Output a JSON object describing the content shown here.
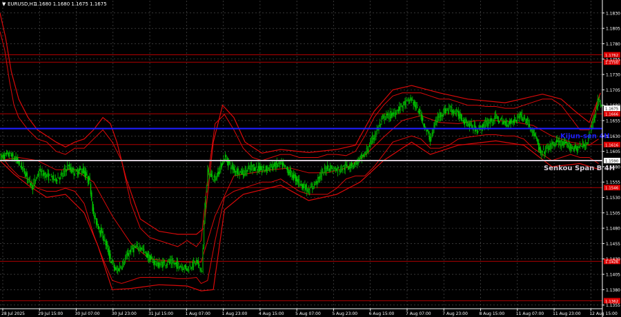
{
  "header": {
    "symbol": "EURUSD,H1",
    "ohlc": "1.1680 1.1680 1.1675 1.1675"
  },
  "chart_data": {
    "type": "candlestick",
    "colors": {
      "background": "#000000",
      "grid": "#5a5a5a",
      "candle_up": "#00c800",
      "candle_down": "#00c800",
      "bollinger_bands": "#dc0a0a",
      "level_lines": "#b40000",
      "kijun_sen": "#1e1eff",
      "senkou_span_b": "#d6cbd6",
      "axis_text": "#ffffff"
    },
    "ylim": [
      1.1349,
      1.185
    ],
    "y_ticks": [
      "1.1830",
      "1.1805",
      "1.1780",
      "1.1755",
      "1.1730",
      "1.1705",
      "1.1680",
      "1.1655",
      "1.1630",
      "1.1605",
      "1.1580",
      "1.1555",
      "1.1530",
      "1.1505",
      "1.1480",
      "1.1455",
      "1.1430",
      "1.1405",
      "1.1380",
      "1.1355"
    ],
    "x_ticks": [
      "28 Jul 2025",
      "29 Jul 15:00",
      "30 Jul 07:00",
      "30 Jul 23:00",
      "31 Jul 15:00",
      "1 Aug 07:00",
      "1 Aug 23:00",
      "4 Aug 15:00",
      "5 Aug 07:00",
      "5 Aug 23:00",
      "6 Aug 15:00",
      "7 Aug 07:00",
      "7 Aug 23:00",
      "8 Aug 15:00",
      "11 Aug 07:00",
      "11 Aug 23:00",
      "12 Aug 15:00"
    ],
    "horizontal_levels": [
      {
        "value": 1.1762,
        "label": "1.1762",
        "color": "#b40000"
      },
      {
        "value": 1.175,
        "label": "1.1750",
        "color": "#b40000"
      },
      {
        "value": 1.1666,
        "label": "1.1666",
        "color": "#b40000"
      },
      {
        "value": 1.1616,
        "label": "1.1616",
        "color": "#b40000"
      },
      {
        "value": 1.1546,
        "label": "1.1546",
        "color": "#b40000"
      },
      {
        "value": 1.1426,
        "label": "1.1426",
        "color": "#b40000"
      },
      {
        "value": 1.1362,
        "label": "1.1362",
        "color": "#b40000"
      }
    ],
    "kijun_sen": {
      "value": 1.1642,
      "label": "Kijun-sen 4H"
    },
    "senkou_span_b": {
      "value": 1.159,
      "price_label": "1.1590",
      "label": "Senkou Span B 4H"
    },
    "current_price": {
      "value": 1.1675,
      "label": "1.1675"
    },
    "close_path": [
      [
        0,
        1.1595
      ],
      [
        10,
        1.16
      ],
      [
        18,
        1.159
      ],
      [
        25,
        1.1575
      ],
      [
        30,
        1.156
      ],
      [
        35,
        1.1548
      ],
      [
        42,
        1.1572
      ],
      [
        50,
        1.1565
      ],
      [
        58,
        1.156
      ],
      [
        66,
        1.1565
      ],
      [
        72,
        1.158
      ],
      [
        80,
        1.157
      ],
      [
        88,
        1.1575
      ],
      [
        96,
        1.1555
      ],
      [
        100,
        1.15
      ],
      [
        106,
        1.148
      ],
      [
        112,
        1.146
      ],
      [
        118,
        1.143
      ],
      [
        124,
        1.141
      ],
      [
        130,
        1.142
      ],
      [
        140,
        1.1445
      ],
      [
        150,
        1.145
      ],
      [
        160,
        1.143
      ],
      [
        170,
        1.142
      ],
      [
        180,
        1.1425
      ],
      [
        190,
        1.142
      ],
      [
        200,
        1.1415
      ],
      [
        210,
        1.1425
      ],
      [
        216,
        1.141
      ],
      [
        219,
        1.152
      ],
      [
        222,
        1.157
      ],
      [
        230,
        1.156
      ],
      [
        240,
        1.1595
      ],
      [
        250,
        1.1575
      ],
      [
        260,
        1.157
      ],
      [
        270,
        1.158
      ],
      [
        280,
        1.1575
      ],
      [
        290,
        1.158
      ],
      [
        300,
        1.1585
      ],
      [
        310,
        1.157
      ],
      [
        320,
        1.1555
      ],
      [
        330,
        1.154
      ],
      [
        340,
        1.156
      ],
      [
        350,
        1.158
      ],
      [
        360,
        1.1575
      ],
      [
        370,
        1.158
      ],
      [
        380,
        1.1585
      ],
      [
        390,
        1.16
      ],
      [
        400,
        1.163
      ],
      [
        410,
        1.166
      ],
      [
        420,
        1.1665
      ],
      [
        430,
        1.168
      ],
      [
        440,
        1.169
      ],
      [
        445,
        1.1675
      ],
      [
        450,
        1.1665
      ],
      [
        455,
        1.164
      ],
      [
        460,
        1.1625
      ],
      [
        465,
        1.165
      ],
      [
        470,
        1.1665
      ],
      [
        480,
        1.1675
      ],
      [
        490,
        1.1665
      ],
      [
        500,
        1.165
      ],
      [
        510,
        1.164
      ],
      [
        520,
        1.165
      ],
      [
        530,
        1.166
      ],
      [
        540,
        1.165
      ],
      [
        550,
        1.1655
      ],
      [
        556,
        1.1665
      ],
      [
        565,
        1.165
      ],
      [
        572,
        1.163
      ],
      [
        578,
        1.16
      ],
      [
        585,
        1.161
      ],
      [
        595,
        1.162
      ],
      [
        605,
        1.1615
      ],
      [
        615,
        1.161
      ],
      [
        625,
        1.1615
      ],
      [
        630,
        1.163
      ],
      [
        635,
        1.166
      ],
      [
        640,
        1.169
      ],
      [
        644,
        1.1675
      ]
    ],
    "bollinger_upper": [
      [
        0,
        1.18
      ],
      [
        5,
        1.177
      ],
      [
        10,
        1.172
      ],
      [
        15,
        1.168
      ],
      [
        20,
        1.166
      ],
      [
        30,
        1.164
      ],
      [
        40,
        1.1625
      ],
      [
        50,
        1.162
      ],
      [
        60,
        1.1605
      ],
      [
        70,
        1.16
      ],
      [
        80,
        1.161
      ],
      [
        90,
        1.161
      ],
      [
        100,
        1.1625
      ],
      [
        110,
        1.164
      ],
      [
        120,
        1.162
      ],
      [
        130,
        1.159
      ],
      [
        140,
        1.152
      ],
      [
        150,
        1.148
      ],
      [
        160,
        1.1465
      ],
      [
        170,
        1.146
      ],
      [
        180,
        1.1455
      ],
      [
        190,
        1.145
      ],
      [
        200,
        1.146
      ],
      [
        210,
        1.145
      ],
      [
        215,
        1.146
      ],
      [
        222,
        1.156
      ],
      [
        230,
        1.165
      ],
      [
        240,
        1.1665
      ],
      [
        250,
        1.164
      ],
      [
        260,
        1.161
      ],
      [
        270,
        1.1595
      ],
      [
        280,
        1.159
      ],
      [
        290,
        1.1595
      ],
      [
        300,
        1.16
      ],
      [
        310,
        1.16
      ],
      [
        320,
        1.1595
      ],
      [
        330,
        1.1595
      ],
      [
        340,
        1.1595
      ],
      [
        350,
        1.16
      ],
      [
        360,
        1.16
      ],
      [
        370,
        1.1598
      ],
      [
        380,
        1.1605
      ],
      [
        390,
        1.163
      ],
      [
        400,
        1.166
      ],
      [
        410,
        1.168
      ],
      [
        420,
        1.1695
      ],
      [
        430,
        1.17
      ],
      [
        440,
        1.17
      ],
      [
        450,
        1.17
      ],
      [
        460,
        1.1695
      ],
      [
        470,
        1.169
      ],
      [
        480,
        1.169
      ],
      [
        490,
        1.1685
      ],
      [
        500,
        1.168
      ],
      [
        510,
        1.168
      ],
      [
        520,
        1.1678
      ],
      [
        530,
        1.1678
      ],
      [
        540,
        1.1675
      ],
      [
        550,
        1.1675
      ],
      [
        560,
        1.168
      ],
      [
        570,
        1.1685
      ],
      [
        580,
        1.169
      ],
      [
        590,
        1.169
      ],
      [
        600,
        1.168
      ],
      [
        610,
        1.166
      ],
      [
        620,
        1.164
      ],
      [
        630,
        1.164
      ],
      [
        640,
        1.169
      ]
    ],
    "bollinger_lower": [
      [
        0,
        1.16
      ],
      [
        10,
        1.158
      ],
      [
        20,
        1.1565
      ],
      [
        30,
        1.156
      ],
      [
        40,
        1.1545
      ],
      [
        50,
        1.154
      ],
      [
        60,
        1.154
      ],
      [
        70,
        1.1545
      ],
      [
        80,
        1.154
      ],
      [
        90,
        1.152
      ],
      [
        100,
        1.147
      ],
      [
        110,
        1.143
      ],
      [
        120,
        1.1395
      ],
      [
        130,
        1.139
      ],
      [
        140,
        1.1395
      ],
      [
        150,
        1.14
      ],
      [
        160,
        1.14
      ],
      [
        170,
        1.14
      ],
      [
        180,
        1.14
      ],
      [
        190,
        1.1398
      ],
      [
        200,
        1.1398
      ],
      [
        210,
        1.14
      ],
      [
        215,
        1.139
      ],
      [
        222,
        1.1395
      ],
      [
        230,
        1.146
      ],
      [
        240,
        1.153
      ],
      [
        250,
        1.154
      ],
      [
        260,
        1.1545
      ],
      [
        270,
        1.155
      ],
      [
        280,
        1.1555
      ],
      [
        290,
        1.1555
      ],
      [
        300,
        1.156
      ],
      [
        310,
        1.155
      ],
      [
        320,
        1.154
      ],
      [
        330,
        1.1535
      ],
      [
        340,
        1.1535
      ],
      [
        350,
        1.1535
      ],
      [
        360,
        1.1545
      ],
      [
        370,
        1.156
      ],
      [
        380,
        1.1565
      ],
      [
        390,
        1.1565
      ],
      [
        400,
        1.158
      ],
      [
        410,
        1.16
      ],
      [
        420,
        1.162
      ],
      [
        430,
        1.1625
      ],
      [
        440,
        1.163
      ],
      [
        450,
        1.1625
      ],
      [
        460,
        1.161
      ],
      [
        470,
        1.161
      ],
      [
        480,
        1.1615
      ],
      [
        490,
        1.1625
      ],
      [
        500,
        1.1628
      ],
      [
        510,
        1.163
      ],
      [
        520,
        1.1632
      ],
      [
        530,
        1.1632
      ],
      [
        540,
        1.163
      ],
      [
        550,
        1.163
      ],
      [
        560,
        1.1625
      ],
      [
        570,
        1.161
      ],
      [
        580,
        1.16
      ],
      [
        590,
        1.159
      ],
      [
        600,
        1.1595
      ],
      [
        610,
        1.16
      ],
      [
        620,
        1.1595
      ],
      [
        630,
        1.1595
      ],
      [
        640,
        1.1585
      ]
    ],
    "bollinger_middle": [
      [
        0,
        1.159
      ],
      [
        20,
        1.1595
      ],
      [
        40,
        1.159
      ],
      [
        60,
        1.1575
      ],
      [
        80,
        1.1575
      ],
      [
        100,
        1.1555
      ],
      [
        120,
        1.15
      ],
      [
        140,
        1.1455
      ],
      [
        160,
        1.143
      ],
      [
        180,
        1.1427
      ],
      [
        200,
        1.1425
      ],
      [
        215,
        1.1425
      ],
      [
        230,
        1.15
      ],
      [
        250,
        1.1565
      ],
      [
        270,
        1.157
      ],
      [
        290,
        1.1575
      ],
      [
        310,
        1.1578
      ],
      [
        330,
        1.157
      ],
      [
        350,
        1.157
      ],
      [
        370,
        1.1578
      ],
      [
        390,
        1.1598
      ],
      [
        410,
        1.1628
      ],
      [
        430,
        1.1655
      ],
      [
        450,
        1.1663
      ],
      [
        470,
        1.1652
      ],
      [
        490,
        1.165
      ],
      [
        510,
        1.1655
      ],
      [
        530,
        1.1655
      ],
      [
        550,
        1.1653
      ],
      [
        570,
        1.1647
      ],
      [
        590,
        1.163
      ],
      [
        610,
        1.162
      ],
      [
        630,
        1.1615
      ],
      [
        640,
        1.1625
      ]
    ],
    "bollinger_outer_upper": [
      [
        0,
        1.183
      ],
      [
        6,
        1.179
      ],
      [
        12,
        1.1735
      ],
      [
        20,
        1.169
      ],
      [
        30,
        1.166
      ],
      [
        40,
        1.164
      ],
      [
        50,
        1.163
      ],
      [
        60,
        1.162
      ],
      [
        70,
        1.1612
      ],
      [
        80,
        1.162
      ],
      [
        90,
        1.1625
      ],
      [
        100,
        1.164
      ],
      [
        110,
        1.166
      ],
      [
        118,
        1.165
      ],
      [
        125,
        1.162
      ],
      [
        135,
        1.156
      ],
      [
        150,
        1.1495
      ],
      [
        170,
        1.1475
      ],
      [
        190,
        1.147
      ],
      [
        210,
        1.147
      ],
      [
        218,
        1.148
      ],
      [
        228,
        1.162
      ],
      [
        238,
        1.168
      ],
      [
        250,
        1.166
      ],
      [
        262,
        1.162
      ],
      [
        280,
        1.1602
      ],
      [
        300,
        1.1608
      ],
      [
        330,
        1.1603
      ],
      [
        360,
        1.1608
      ],
      [
        380,
        1.1615
      ],
      [
        400,
        1.167
      ],
      [
        420,
        1.1705
      ],
      [
        440,
        1.1712
      ],
      [
        470,
        1.17
      ],
      [
        500,
        1.169
      ],
      [
        540,
        1.1684
      ],
      [
        580,
        1.1698
      ],
      [
        600,
        1.169
      ],
      [
        615,
        1.167
      ],
      [
        630,
        1.1652
      ],
      [
        642,
        1.17
      ]
    ],
    "bollinger_outer_lower": [
      [
        0,
        1.159
      ],
      [
        15,
        1.1568
      ],
      [
        30,
        1.155
      ],
      [
        50,
        1.153
      ],
      [
        70,
        1.1535
      ],
      [
        90,
        1.1505
      ],
      [
        105,
        1.145
      ],
      [
        120,
        1.138
      ],
      [
        140,
        1.1382
      ],
      [
        170,
        1.1388
      ],
      [
        200,
        1.1386
      ],
      [
        215,
        1.1378
      ],
      [
        228,
        1.138
      ],
      [
        240,
        1.151
      ],
      [
        260,
        1.1535
      ],
      [
        300,
        1.155
      ],
      [
        330,
        1.1525
      ],
      [
        360,
        1.1535
      ],
      [
        385,
        1.1555
      ],
      [
        410,
        1.159
      ],
      [
        440,
        1.162
      ],
      [
        460,
        1.16
      ],
      [
        490,
        1.1615
      ],
      [
        530,
        1.1622
      ],
      [
        560,
        1.1615
      ],
      [
        590,
        1.158
      ],
      [
        620,
        1.1585
      ],
      [
        642,
        1.1575
      ]
    ]
  }
}
